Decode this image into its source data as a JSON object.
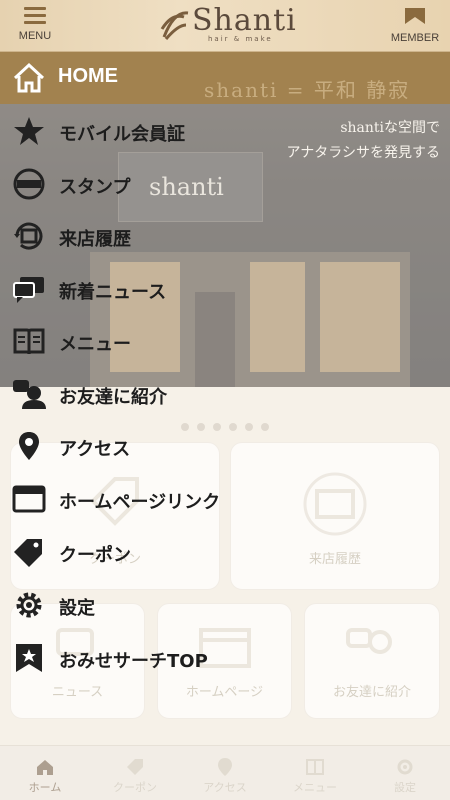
{
  "header": {
    "menu_label": "MENU",
    "member_label": "MEMBER",
    "logo_text": "Shanti",
    "logo_sub": "hair & make"
  },
  "hero": {
    "sign_text": "shanti",
    "tagline_jp": "shanti = 平和 静寂",
    "desc_line1": "shantiな空間で",
    "desc_line2": "アナタラシサを発見する"
  },
  "drawer": {
    "home_label": "HOME",
    "items": [
      {
        "label": "モバイル会員証",
        "icon": "star-icon"
      },
      {
        "label": "スタンプ",
        "icon": "stamp-icon"
      },
      {
        "label": "来店履歴",
        "icon": "visit-history-icon"
      },
      {
        "label": "新着ニュース",
        "icon": "chat-bubbles-icon"
      },
      {
        "label": "メニュー",
        "icon": "book-icon"
      },
      {
        "label": "お友達に紹介",
        "icon": "user-refer-icon"
      },
      {
        "label": "アクセス",
        "icon": "map-pin-icon"
      },
      {
        "label": "ホームページリンク",
        "icon": "browser-icon"
      },
      {
        "label": "クーポン",
        "icon": "tag-icon"
      },
      {
        "label": "設定",
        "icon": "gear-icon"
      },
      {
        "label": "おみせサーチTOP",
        "icon": "bookmark-star-icon"
      }
    ]
  },
  "tiles": {
    "coupon": "クーポン",
    "visit_history": "来店履歴",
    "news": "ニュース",
    "homepage": "ホームページ",
    "refer": "お友達に紹介"
  },
  "tabbar": {
    "tabs": [
      {
        "label": "ホーム",
        "icon": "home-icon",
        "active": true
      },
      {
        "label": "クーポン",
        "icon": "tag-icon",
        "active": false
      },
      {
        "label": "アクセス",
        "icon": "map-pin-icon",
        "active": false
      },
      {
        "label": "メニュー",
        "icon": "book-icon",
        "active": false
      },
      {
        "label": "設定",
        "icon": "gear-icon",
        "active": false
      }
    ]
  },
  "colors": {
    "accent": "#a2824f",
    "header_bg": "#e9d6b4",
    "text": "#1d1d1d"
  }
}
